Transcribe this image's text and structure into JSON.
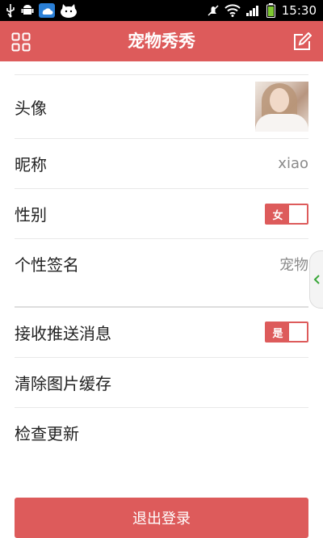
{
  "status_bar": {
    "time": "15:30"
  },
  "header": {
    "title": "宠物秀秀",
    "menu_icon": "grid-menu-icon",
    "edit_icon": "edit-icon"
  },
  "profile": {
    "avatar_label": "头像",
    "nickname_label": "昵称",
    "nickname_value": "xiao",
    "gender_label": "性别",
    "gender_value": "女",
    "signature_label": "个性签名",
    "signature_value": "宠物"
  },
  "settings": {
    "push_label": "接收推送消息",
    "push_value": "是",
    "clear_cache_label": "清除图片缓存",
    "check_update_label": "检查更新"
  },
  "logout_label": "退出登录",
  "colors": {
    "accent": "#dd5b5b",
    "status_bar": "#000000",
    "text": "#222222",
    "secondary_text": "#8a8a8a",
    "battery": "#7ec832"
  }
}
